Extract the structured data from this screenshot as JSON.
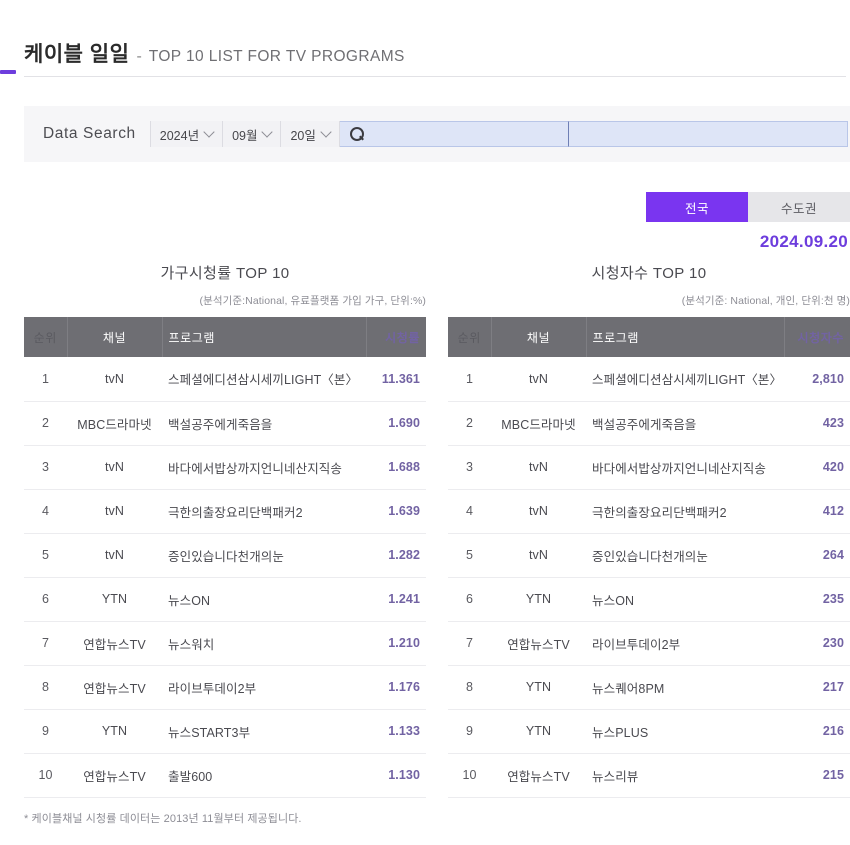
{
  "header": {
    "title_ko": "케이블 일일",
    "dash": "-",
    "title_en": "TOP 10 LIST FOR TV PROGRAMS"
  },
  "search": {
    "label": "Data Search",
    "year": "2024년",
    "month": "09월",
    "day": "20일",
    "keyword_value": "",
    "keyword_placeholder": "",
    "secondary_value": "",
    "secondary_placeholder": ""
  },
  "region_toggle": {
    "active_label": "전국",
    "inactive_label": "수도권",
    "active_color": "#7a35f0",
    "inactive_color": "#e6e6e9"
  },
  "date_label": "2024.09.20",
  "accent_color": "#6d3ddd",
  "value_color": "#7263a3",
  "footnote": "* 케이블채널 시청률 데이터는 2013년 11월부터 제공됩니다.",
  "tables": [
    {
      "title": "가구시청률 TOP 10",
      "subtitle": "(분석기준:National, 유료플랫폼 가입 가구, 단위:%)",
      "columns": [
        "순위",
        "채널",
        "프로그램",
        "시청률"
      ],
      "rows": [
        {
          "rank": "1",
          "channel": "tvN",
          "program": "스페셜에디션삼시세끼LIGHT〈본〉",
          "value": "11.361"
        },
        {
          "rank": "2",
          "channel": "MBC드라마넷",
          "program": "백설공주에게죽음을",
          "value": "1.690"
        },
        {
          "rank": "3",
          "channel": "tvN",
          "program": "바다에서밥상까지언니네산지직송",
          "value": "1.688"
        },
        {
          "rank": "4",
          "channel": "tvN",
          "program": "극한의출장요리단백패커2",
          "value": "1.639"
        },
        {
          "rank": "5",
          "channel": "tvN",
          "program": "증인있습니다천개의눈",
          "value": "1.282"
        },
        {
          "rank": "6",
          "channel": "YTN",
          "program": "뉴스ON",
          "value": "1.241"
        },
        {
          "rank": "7",
          "channel": "연합뉴스TV",
          "program": "뉴스워치",
          "value": "1.210"
        },
        {
          "rank": "8",
          "channel": "연합뉴스TV",
          "program": "라이브투데이2부",
          "value": "1.176"
        },
        {
          "rank": "9",
          "channel": "YTN",
          "program": "뉴스START3부",
          "value": "1.133"
        },
        {
          "rank": "10",
          "channel": "연합뉴스TV",
          "program": "출발600",
          "value": "1.130"
        }
      ]
    },
    {
      "title": "시청자수 TOP 10",
      "subtitle": "(분석기준: National, 개인, 단위:천 명)",
      "columns": [
        "순위",
        "채널",
        "프로그램",
        "시청자수"
      ],
      "rows": [
        {
          "rank": "1",
          "channel": "tvN",
          "program": "스페셜에디션삼시세끼LIGHT〈본〉",
          "value": "2,810"
        },
        {
          "rank": "2",
          "channel": "MBC드라마넷",
          "program": "백설공주에게죽음을",
          "value": "423"
        },
        {
          "rank": "3",
          "channel": "tvN",
          "program": "바다에서밥상까지언니네산지직송",
          "value": "420"
        },
        {
          "rank": "4",
          "channel": "tvN",
          "program": "극한의출장요리단백패커2",
          "value": "412"
        },
        {
          "rank": "5",
          "channel": "tvN",
          "program": "증인있습니다천개의눈",
          "value": "264"
        },
        {
          "rank": "6",
          "channel": "YTN",
          "program": "뉴스ON",
          "value": "235"
        },
        {
          "rank": "7",
          "channel": "연합뉴스TV",
          "program": "라이브투데이2부",
          "value": "230"
        },
        {
          "rank": "8",
          "channel": "YTN",
          "program": "뉴스퀘어8PM",
          "value": "217"
        },
        {
          "rank": "9",
          "channel": "YTN",
          "program": "뉴스PLUS",
          "value": "216"
        },
        {
          "rank": "10",
          "channel": "연합뉴스TV",
          "program": "뉴스리뷰",
          "value": "215"
        }
      ]
    }
  ],
  "icons": {
    "search": "search-icon",
    "chevron": "chevron-down-icon"
  }
}
